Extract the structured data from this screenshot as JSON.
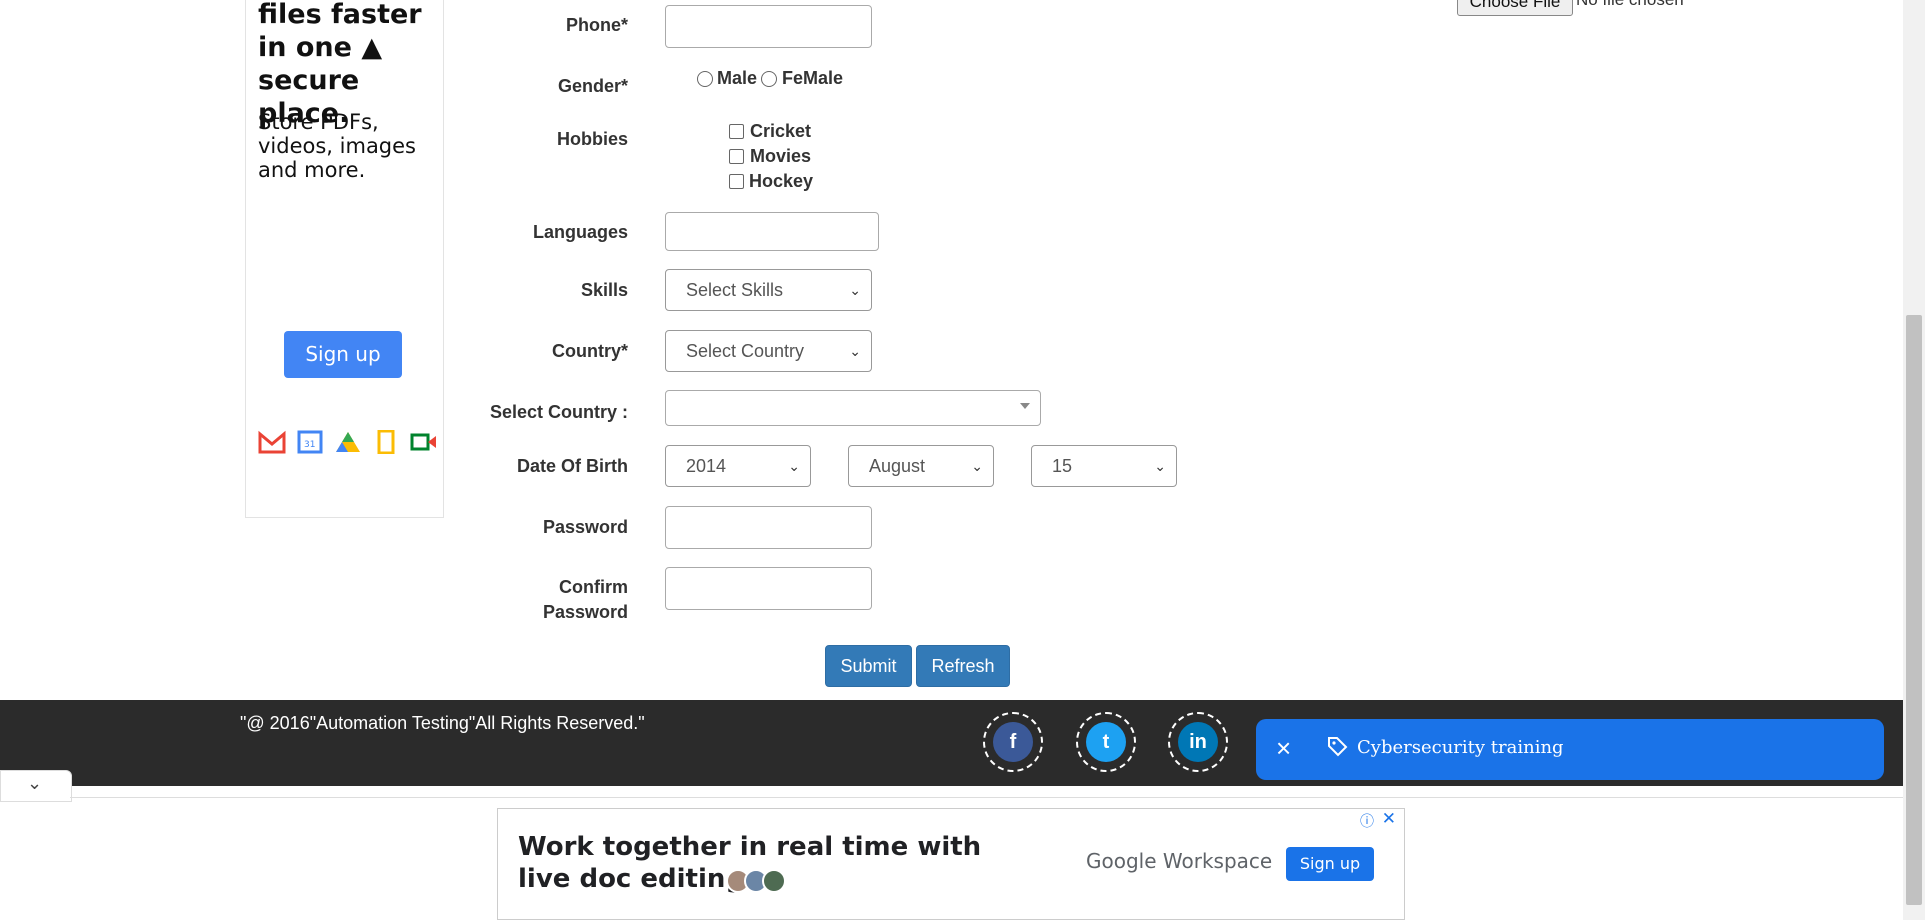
{
  "ad_left": {
    "headline": "files faster in one ▲ secure place.",
    "subtext": "Store PDFs, videos, images and more.",
    "signup": "Sign up",
    "icons": [
      "gmail-icon",
      "calendar-icon",
      "drive-icon",
      "docs-icon",
      "meet-icon"
    ]
  },
  "file_upload": {
    "button": "Choose File",
    "status": "No file chosen"
  },
  "form": {
    "phone_label": "Phone*",
    "gender_label": "Gender*",
    "gender_male": "Male",
    "gender_female": "FeMale",
    "hobbies_label": "Hobbies",
    "hobby_1": "Cricket",
    "hobby_2": "Movies",
    "hobby_3": "Hockey",
    "languages_label": "Languages",
    "skills_label": "Skills",
    "skills_value": "Select Skills",
    "country_label": "Country*",
    "country_value": "Select Country",
    "select_country_label": "Select Country :",
    "dob_label": "Date Of Birth",
    "dob_year": "2014",
    "dob_month": "August",
    "dob_day": "15",
    "password_label": "Password",
    "confirm_label_1": "Confirm",
    "confirm_label_2": "Password",
    "submit": "Submit",
    "refresh": "Refresh"
  },
  "footer": {
    "copyright": "\"@ 2016\"Automation Testing\"All Rights Reserved.\"",
    "social": [
      "facebook-icon",
      "twitter-icon",
      "linkedin-icon"
    ]
  },
  "toast": {
    "text": "Cybersecurity training"
  },
  "ad_bottom": {
    "line1": "Work together in real time with",
    "line2": "live doc editing.",
    "brand": "Google Workspace",
    "signup": "Sign up"
  },
  "colors": {
    "primary_button": "#337ab7",
    "footer_bg": "#2b2b2b",
    "toast_bg": "#1a73e8",
    "ad_signup": "#4285f4"
  }
}
